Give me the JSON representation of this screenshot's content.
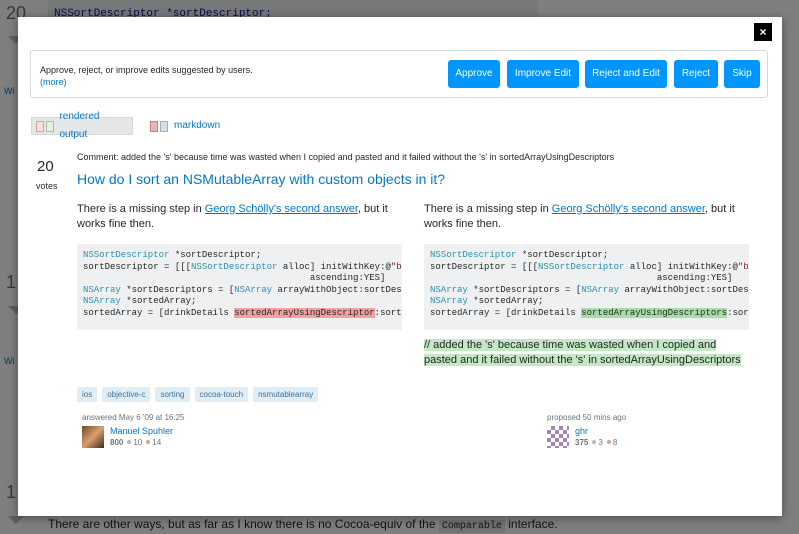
{
  "background": {
    "top_code": "NSSortDescriptor *sortDescriptor;",
    "vote_numbers": [
      "20",
      "1",
      "1"
    ],
    "wiki_label": "Wi",
    "bottom_text": "There are other ways, but as far as I know there is no Cocoa-equiv of the",
    "bottom_code": "Comparable",
    "bottom_suffix": "interface."
  },
  "modal": {
    "close_label": "×",
    "review": {
      "instructions": "Approve, reject, or improve edits suggested by users.",
      "more_link": "(more)",
      "buttons": {
        "approve": "Approve",
        "improve": "Improve Edit",
        "reject_edit": "Reject and Edit",
        "reject": "Reject",
        "skip": "Skip"
      }
    },
    "view_toggles": {
      "rendered": "rendered output",
      "markdown": "markdown"
    },
    "post": {
      "votes": "20",
      "votes_label": "votes",
      "edit_comment": "Comment: added the 's' because time was wasted when I copied and pasted and it failed without the 's' in sortedArrayUsingDescriptors",
      "title": "How do I sort an NSMutableArray with custom objects in it?",
      "para_prefix": "There is a missing step in ",
      "para_link": "Georg Schölly's second answer",
      "para_suffix": ", but it works fine then.",
      "left_code": {
        "l1_kw": "NSSortDescriptor",
        "l1_rest": " *sortDescriptor;",
        "l2_a": "sortDescriptor = [[[",
        "l2_kw": "NSSortDescriptor",
        "l2_b": " alloc] initWithKey:@",
        "l2_str": "\"bi",
        "l3": "                                          ascending:YES]",
        "l4_kw": "NSArray",
        "l4_a": " *sortDescriptors = [",
        "l4_kw2": "NSArray",
        "l4_b": " arrayWithObject:sortDesc",
        "l5_kw": "NSArray",
        "l5_rest": " *sortedArray;",
        "l6_a": "sortedArray = [drinkDetails ",
        "l6_del": "sortedArrayUsingDescriptor",
        "l6_b": ":sortD"
      },
      "right_code": {
        "l6_a": "sortedArray = [drinkDetails ",
        "l6_ins": "sortedArrayUsingDescriptors",
        "l6_b": ":sort"
      },
      "added_comment": "// added the 's' because time was wasted when I copied and pasted and it failed without the 's' in sortedArrayUsingDescriptors",
      "tags": [
        "ios",
        "objective-c",
        "sorting",
        "cocoa-touch",
        "nsmutablearray"
      ],
      "answered": {
        "action": "answered May 6 '09 at 16:25",
        "user": "Manuel Spuhler",
        "rep": "800",
        "silver": "10",
        "bronze": "14"
      },
      "proposed": {
        "action": "proposed 50 mins ago",
        "user": "ghr",
        "rep": "375",
        "silver": "3",
        "bronze": "8"
      }
    }
  }
}
